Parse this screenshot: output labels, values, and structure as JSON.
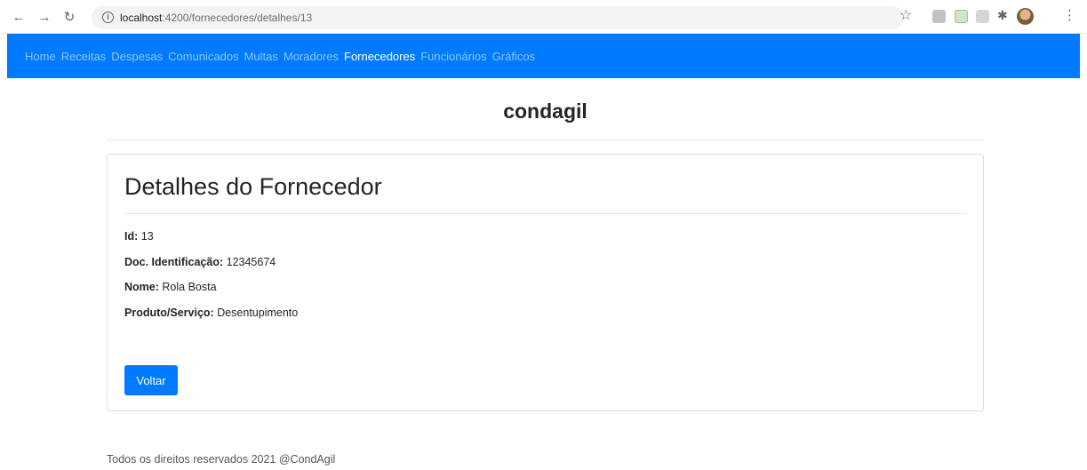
{
  "browser": {
    "url_host": "localhost",
    "url_rest": ":4200/fornecedores/detalhes/13",
    "icons": [
      "back-arrow-icon",
      "forward-arrow-icon",
      "reload-icon",
      "info-icon",
      "star-icon",
      "puzzle-icon",
      "menu-icon"
    ]
  },
  "navbar": {
    "color": "#007bff",
    "items": [
      {
        "label": "Home",
        "active": false
      },
      {
        "label": "Receitas",
        "active": false
      },
      {
        "label": "Despesas",
        "active": false
      },
      {
        "label": "Comunicados",
        "active": false
      },
      {
        "label": "Multas",
        "active": false
      },
      {
        "label": "Moradores",
        "active": false
      },
      {
        "label": "Fornecedores",
        "active": true
      },
      {
        "label": "Funcionários",
        "active": false
      },
      {
        "label": "Gráficos",
        "active": false
      }
    ]
  },
  "header": {
    "brand": "condagil"
  },
  "card": {
    "title": "Detalhes do Fornecedor",
    "fields": {
      "id_label": "Id:",
      "id_value": "13",
      "doc_label": "Doc. Identificação:",
      "doc_value": "12345674",
      "nome_label": "Nome:",
      "nome_value": "Rola Bosta",
      "produto_label": "Produto/Serviço:",
      "produto_value": "Desentupimento"
    },
    "back_button_label": "Voltar"
  },
  "footer": {
    "text": "Todos os direitos reservados 2021 @CondAgil"
  }
}
